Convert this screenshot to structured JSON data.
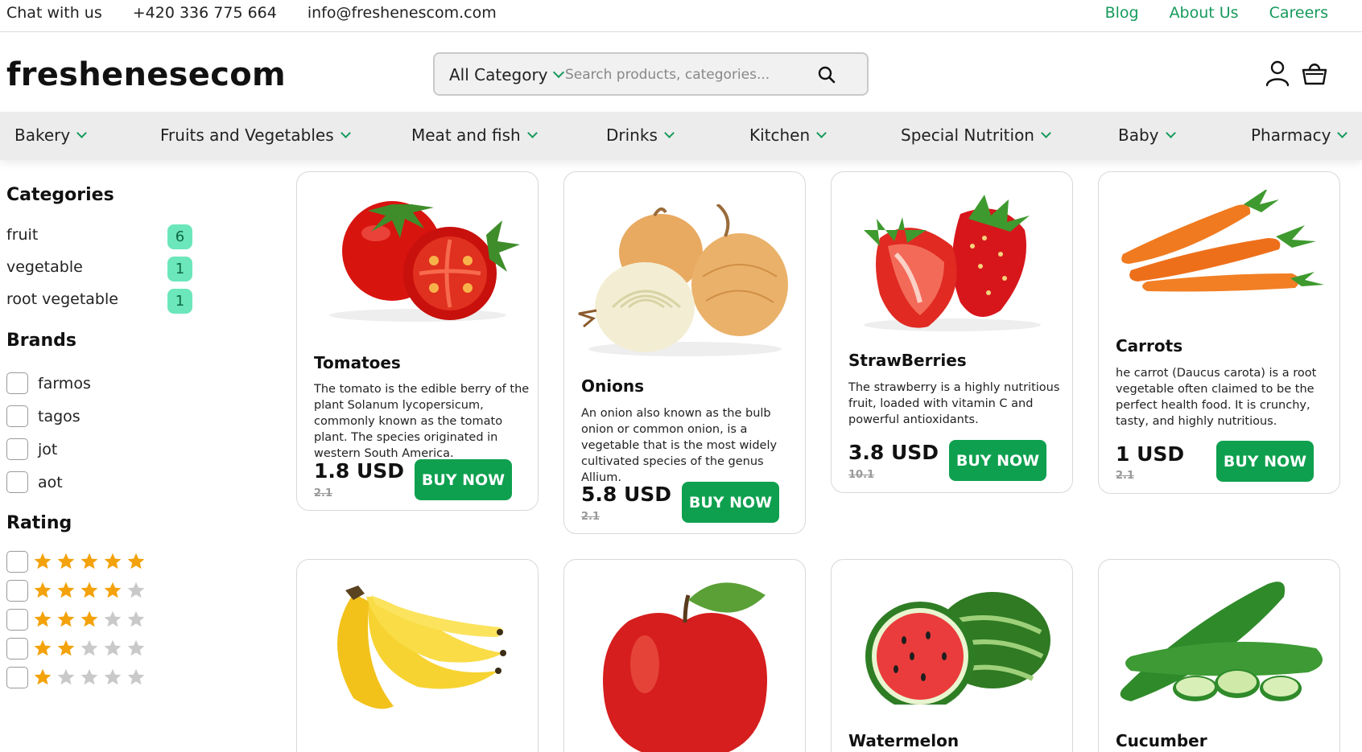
{
  "topbar": {
    "chat": "Chat with us",
    "phone": "+420 336 775 664",
    "email": "info@freshenescom.com",
    "links": [
      "Blog",
      "About Us",
      "Careers"
    ]
  },
  "header": {
    "logo": "freshenesecom",
    "category_select": "All Category",
    "search_placeholder": "Search products, categories..."
  },
  "nav": [
    "Bakery",
    "Fruits and Vegetables",
    "Meat and fish",
    "Drinks",
    "Kitchen",
    "Special Nutrition",
    "Baby",
    "Pharmacy"
  ],
  "sidebar": {
    "categories_title": "Categories",
    "categories": [
      {
        "label": "fruit",
        "count": "6"
      },
      {
        "label": "vegetable",
        "count": "1"
      },
      {
        "label": "root vegetable",
        "count": "1"
      }
    ],
    "brands_title": "Brands",
    "brands": [
      "farmos",
      "tagos",
      "jot",
      "aot"
    ],
    "rating_title": "Rating",
    "ratings": [
      5,
      4,
      3,
      2,
      1
    ]
  },
  "products": [
    {
      "name": "Tomatoes",
      "desc": "The tomato is the edible berry of the plant Solanum lycopersicum, commonly known as the tomato plant. The species originated in western South America.",
      "price": "1.8 USD",
      "old_price": "2.1",
      "buy": "BUY NOW"
    },
    {
      "name": "Onions",
      "desc": "An onion also known as the bulb onion or common onion, is a vegetable that is the most widely cultivated species of the genus Allium.",
      "price": "5.8 USD",
      "old_price": "2.1",
      "buy": "BUY NOW"
    },
    {
      "name": "StrawBerries",
      "desc": "The strawberry is a highly nutritious fruit, loaded with vitamin C and powerful antioxidants.",
      "price": "3.8 USD",
      "old_price": "10.1",
      "buy": "BUY NOW"
    },
    {
      "name": "Carrots",
      "desc": "he carrot (Daucus carota) is a root vegetable often claimed to be the perfect health food. It is crunchy, tasty, and highly nutritious.",
      "price": "1 USD",
      "old_price": "2.1",
      "buy": "BUY NOW"
    },
    {
      "name": "",
      "desc": "",
      "price": "",
      "old_price": "",
      "buy": ""
    },
    {
      "name": "",
      "desc": "",
      "price": "",
      "old_price": "",
      "buy": ""
    },
    {
      "name": "Watermelon",
      "desc": "",
      "price": "",
      "old_price": "",
      "buy": ""
    },
    {
      "name": "Cucumber",
      "desc": "",
      "price": "",
      "old_price": "",
      "buy": ""
    }
  ],
  "colors": {
    "accent": "#159a5c",
    "buy_button": "#0ea04f",
    "badge": "#6ce6bb",
    "star": "#f4a20c",
    "star_empty": "#c9c9c9"
  }
}
